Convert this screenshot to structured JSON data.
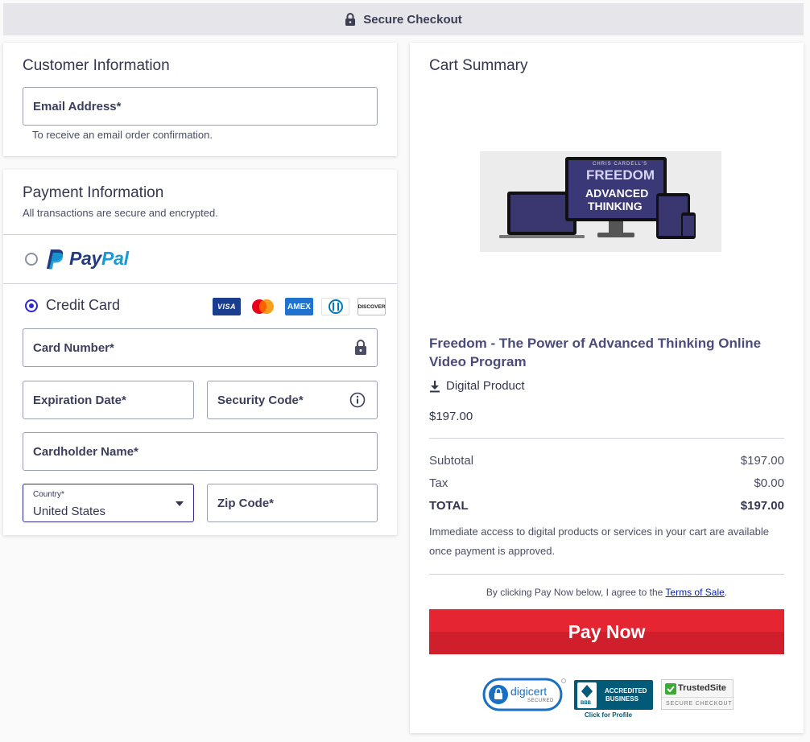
{
  "topbar": {
    "title": "Secure Checkout",
    "icon": "lock-icon"
  },
  "customer": {
    "title": "Customer Information",
    "email_label": "Email Address*",
    "email_hint": "To receive an email order confirmation."
  },
  "payment": {
    "title": "Payment Information",
    "subtitle": "All transactions are secure and encrypted.",
    "paypal": {
      "word_pay": "Pay",
      "word_pal": "Pal",
      "selected": false
    },
    "credit_card": {
      "label": "Credit Card",
      "selected": true,
      "brands": {
        "visa": "VISA",
        "amex": "AMEX",
        "discover": "DISCOVER"
      }
    },
    "card_number_label": "Card Number*",
    "expiration_label": "Expiration Date*",
    "security_label": "Security Code*",
    "cardholder_label": "Cardholder Name*",
    "country_label": "Country*",
    "country_value": "United States",
    "zip_label": "Zip Code*"
  },
  "cart": {
    "title": "Cart Summary",
    "product": {
      "image_text": {
        "brand": "CHRIS CARDELL'S",
        "line1": "FREEDOM",
        "line2": "ADVANCED",
        "line3": "THINKING"
      },
      "name": "Freedom - The Power of Advanced Thinking Online Video Program",
      "type": "Digital Product",
      "price": "$197.00"
    },
    "subtotal_label": "Subtotal",
    "subtotal_value": "$197.00",
    "tax_label": "Tax",
    "tax_value": "$0.00",
    "total_label": "TOTAL",
    "total_value": "$197.00",
    "note": "Immediate access to digital products or services in your cart are available once payment is approved.",
    "agree_prefix": "By clicking Pay Now below, I agree to the ",
    "agree_link": "Terms of Sale",
    "agree_suffix": ".",
    "pay_button": "Pay Now",
    "badges": {
      "digicert": {
        "name": "digicert",
        "sub": "SECURED"
      },
      "bbb": {
        "line1": "ACCREDITED",
        "line2": "BUSINESS",
        "logo": "BBB",
        "caption": "Click for Profile"
      },
      "trustedsite": {
        "name": "TrustedSite",
        "sub": "SECURE CHECKOUT"
      }
    }
  },
  "colors": {
    "accent": "#2f26d6",
    "pay_red": "#e62533",
    "paypal_dark": "#253b80",
    "paypal_light": "#179bd7"
  }
}
